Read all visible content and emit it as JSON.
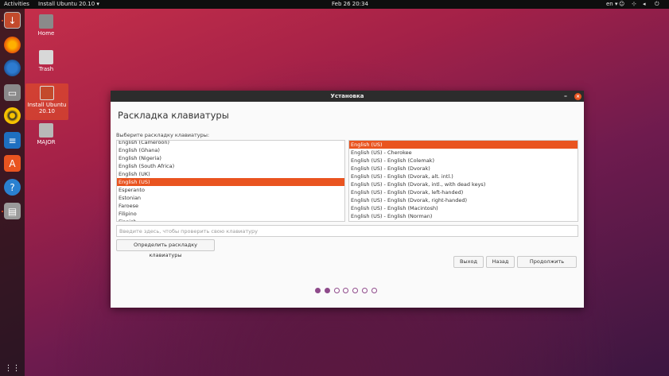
{
  "topbar": {
    "activities": "Activities",
    "app_menu": "Install Ubuntu 20.10 ▾",
    "clock": "Feb 26  20:34",
    "language": "en ▾",
    "icons": [
      "accessibility-icon",
      "network-icon",
      "volume-icon",
      "power-icon"
    ]
  },
  "dock": {
    "items": [
      "installer-icon",
      "firefox-icon",
      "thunderbird-icon",
      "files-icon",
      "rhythmbox-icon",
      "libreoffice-writer-icon",
      "software-center-icon",
      "help-icon",
      "usb-drive-icon",
      "app-grid-icon"
    ]
  },
  "desktop": {
    "icons": [
      {
        "label": "Home"
      },
      {
        "label": "Trash"
      },
      {
        "label": "Install Ubuntu 20.10"
      },
      {
        "label": "MAJOR"
      }
    ]
  },
  "window": {
    "title": "Установка",
    "heading": "Раскладка клавиатуры",
    "subtitle": "Выберите раскладку клавиатуры:",
    "layouts": [
      "English (Cameroon)",
      "English (Ghana)",
      "English (Nigeria)",
      "English (South Africa)",
      "English (UK)",
      "English (US)",
      "Esperanto",
      "Estonian",
      "Faroese",
      "Filipino",
      "Finnish"
    ],
    "selected_layout_index": 5,
    "variants": [
      "English (US)",
      "English (US) - Cherokee",
      "English (US) - English (Colemak)",
      "English (US) - English (Dvorak)",
      "English (US) - English (Dvorak, alt. intl.)",
      "English (US) - English (Dvorak, intl., with dead keys)",
      "English (US) - English (Dvorak, left-handed)",
      "English (US) - English (Dvorak, right-handed)",
      "English (US) - English (Macintosh)",
      "English (US) - English (Norman)"
    ],
    "selected_variant_index": 0,
    "test_input": {
      "value": "",
      "placeholder": "Введите здесь, чтобы проверить свою клавиатуру"
    },
    "detect_button": "Определить раскладку клавиатуры",
    "quit_button": "Выход",
    "back_button": "Назад",
    "continue_button": "Продолжить",
    "progress": {
      "total_steps": 7,
      "completed_steps": 2
    }
  },
  "colors": {
    "accent": "#e95420",
    "progress_dot": "#8e4a8a",
    "topbar": "#0e0e0e",
    "titlebar": "#2c2c2c"
  }
}
